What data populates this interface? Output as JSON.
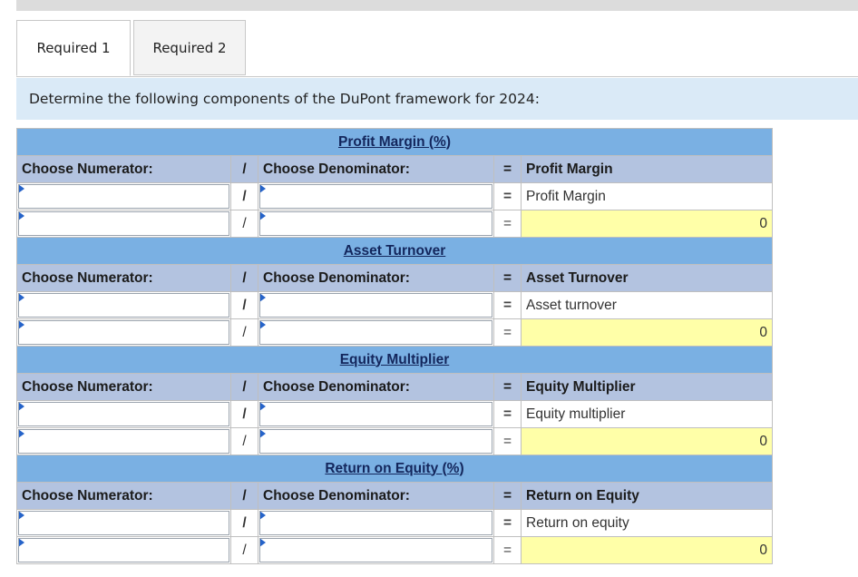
{
  "tabs": [
    {
      "label": "Required 1",
      "active": true
    },
    {
      "label": "Required 2",
      "active": false
    }
  ],
  "instruction": "Determine the following components of the DuPont framework for 2024:",
  "sections": [
    {
      "title": "Profit Margin (%)",
      "numerator_header": "Choose Numerator:",
      "denominator_header": "Choose Denominator:",
      "result_header": "Profit Margin",
      "slash": "/",
      "equals": "=",
      "row1_label": "Profit Margin",
      "result_value": "0"
    },
    {
      "title": "Asset Turnover",
      "numerator_header": "Choose Numerator:",
      "denominator_header": "Choose Denominator:",
      "result_header": "Asset Turnover",
      "slash": "/",
      "equals": "=",
      "row1_label": "Asset turnover",
      "result_value": "0"
    },
    {
      "title": "Equity Multiplier",
      "numerator_header": "Choose Numerator:",
      "denominator_header": "Choose Denominator:",
      "result_header": "Equity Multiplier",
      "slash": "/",
      "equals": "=",
      "row1_label": "Equity multiplier",
      "result_value": "0"
    },
    {
      "title": "Return on Equity (%)",
      "numerator_header": "Choose Numerator:",
      "denominator_header": "Choose Denominator:",
      "result_header": "Return on Equity",
      "slash": "/",
      "equals": "=",
      "row1_label": "Return on equity",
      "result_value": "0"
    }
  ]
}
